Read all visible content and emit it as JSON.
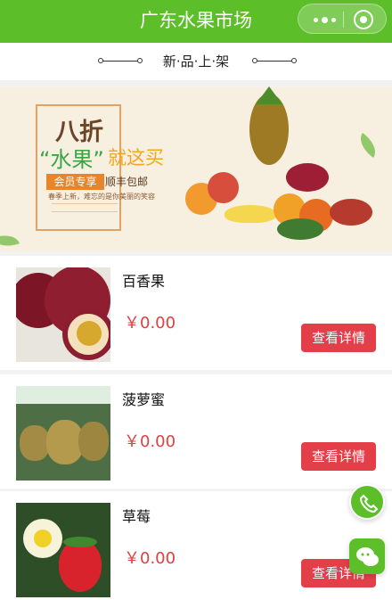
{
  "navbar": {
    "title": "广东水果市场"
  },
  "section": {
    "title": "新·品·上·架"
  },
  "banner": {
    "headline": "八折",
    "subtitle_fruit": "“水果”",
    "subtitle_buy": "就这买",
    "badge": "会员专享",
    "shipping": "顺丰包邮",
    "tagline": "春季上新，难忘的是你美丽的笑容"
  },
  "products": [
    {
      "name": "百香果",
      "price": "￥0.00",
      "button": "查看详情"
    },
    {
      "name": "菠萝蜜",
      "price": "￥0.00",
      "button": "查看详情"
    },
    {
      "name": "草莓",
      "price": "￥0.00",
      "button": "查看详情"
    }
  ],
  "icons": {
    "more": "more-dots-icon",
    "target": "target-icon",
    "call": "phone-icon",
    "chat": "chat-icon"
  },
  "colors": {
    "primary": "#5cbf2a",
    "price": "#e23f3f",
    "button": "#e23f49"
  }
}
